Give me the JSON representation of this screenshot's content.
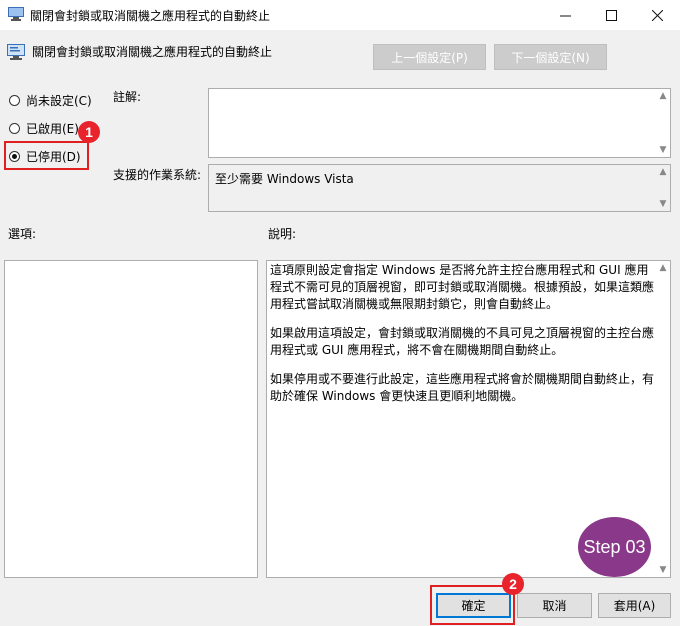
{
  "window": {
    "title": "關閉會封鎖或取消關機之應用程式的自動終止",
    "minimize": "—",
    "maximize": "☐",
    "close": "✕"
  },
  "header": {
    "policy_name": "關閉會封鎖或取消關機之應用程式的自動終止",
    "prev_setting": "上一個設定(P)",
    "next_setting": "下一個設定(N)"
  },
  "state": {
    "options": [
      {
        "label": "尚未設定(C)",
        "selected": false
      },
      {
        "label": "已啟用(E)",
        "selected": false
      },
      {
        "label": "已停用(D)",
        "selected": true
      }
    ]
  },
  "comment": {
    "label": "註解:",
    "value": ""
  },
  "supported": {
    "label": "支援的作業系統:",
    "value": "至少需要 Windows Vista"
  },
  "options_section": {
    "label": "選項:"
  },
  "help_section": {
    "label": "說明:",
    "paragraphs": [
      "這項原則設定會指定 Windows 是否將允許主控台應用程式和 GUI 應用程式不需可見的頂層視窗，即可封鎖或取消關機。根據預設，如果這類應用程式嘗試取消關機或無限期封鎖它，則會自動終止。",
      "如果啟用這項設定，會封鎖或取消關機的不具可見之頂層視窗的主控台應用程式或 GUI 應用程式，將不會在關機期間自動終止。",
      "如果停用或不要進行此設定，這些應用程式將會於關機期間自動終止，有助於確保 Windows 會更快速且更順利地關機。"
    ]
  },
  "footer": {
    "ok": "確定",
    "cancel": "取消",
    "apply": "套用(A)"
  },
  "annotations": {
    "badge1": "1",
    "badge2": "2",
    "step": "Step 03"
  },
  "colors": {
    "highlight": "#e02020",
    "step_badge": "#8a3889"
  }
}
